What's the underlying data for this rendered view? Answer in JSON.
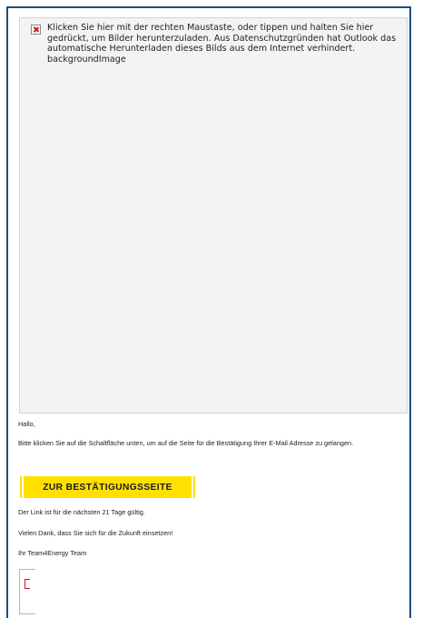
{
  "blocked_image": {
    "message": "Klicken Sie hier mit der rechten Maustaste, oder tippen und halten Sie hier gedrückt, um Bilder herunterzuladen. Aus Datenschutzgründen hat Outlook das automatische Herunterladen dieses Bilds aus dem Internet verhindert.",
    "alt_text": "backgroundImage"
  },
  "email": {
    "greeting": "Hallo,",
    "instruction": "Bitte klicken Sie auf die Schaltfläche unten, um auf die Seite für die Bestätigung Ihrer E-Mail Adresse zu gelangen.",
    "cta_label": "ZUR BESTÄTIGUNGSSEITE",
    "validity": "Der Link ist für die nächsten 21 Tage gültig.",
    "thanks": "Vielen Dank, dass Sie sich für die Zukunft einsetzen!",
    "signature": "Ihr Team4Energy Team"
  },
  "colors": {
    "cta_background": "#ffe000",
    "frame_border": "#1f4e79",
    "blocked_background": "#f3f3f3"
  }
}
